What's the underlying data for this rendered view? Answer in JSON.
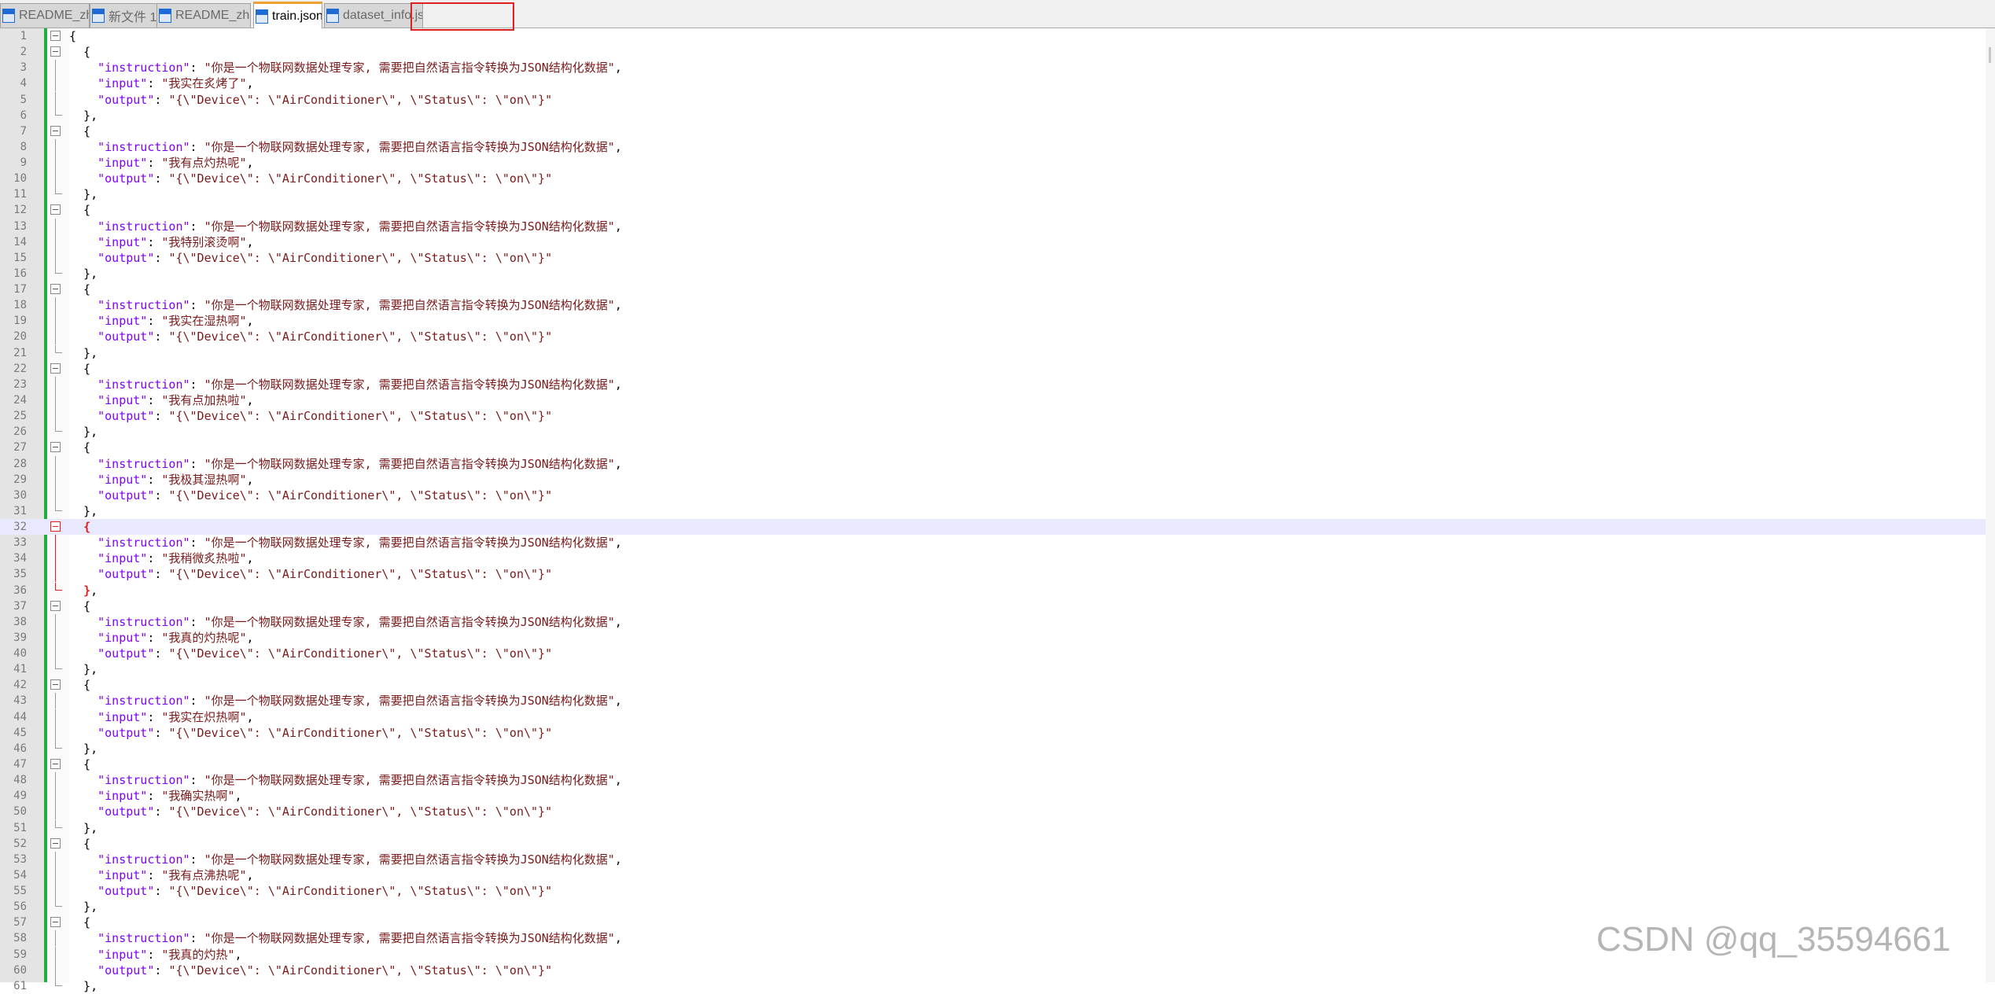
{
  "tabs": [
    {
      "label": "README_zh.md",
      "active": false
    },
    {
      "label": "新文件 1",
      "active": false
    },
    {
      "label": "README_zh.md",
      "active": false
    },
    {
      "label": "train.json",
      "active": true,
      "icons": [
        "pin-icon",
        "close-icon"
      ]
    },
    {
      "label": "dataset_info.json",
      "active": false
    }
  ],
  "editor": {
    "current_line": 32,
    "lines": [
      {
        "n": "1",
        "t": [
          [
            "p",
            "{"
          ]
        ],
        "f": "box"
      },
      {
        "n": "2",
        "t": [
          [
            "p",
            "  {"
          ]
        ],
        "f": "box"
      },
      {
        "n": "3",
        "t": [
          [
            "p",
            "    "
          ],
          [
            "k",
            "\"instruction\""
          ],
          [
            "p",
            ": "
          ],
          [
            "s",
            "\"你是一个物联网数据处理专家, 需要把自然语言指令转换为JSON结构化数据\""
          ],
          [
            "p",
            ","
          ]
        ],
        "f": "line"
      },
      {
        "n": "4",
        "t": [
          [
            "p",
            "    "
          ],
          [
            "k",
            "\"input\""
          ],
          [
            "p",
            ": "
          ],
          [
            "s",
            "\"我实在炙烤了\""
          ],
          [
            "p",
            ","
          ]
        ],
        "f": "line"
      },
      {
        "n": "5",
        "t": [
          [
            "p",
            "    "
          ],
          [
            "k",
            "\"output\""
          ],
          [
            "p",
            ": "
          ],
          [
            "s",
            "\"{\\\"Device\\\": \\\"AirConditioner\\\", \\\"Status\\\": \\\"on\\\"}\""
          ]
        ],
        "f": "line"
      },
      {
        "n": "6",
        "t": [
          [
            "p",
            "  },"
          ]
        ],
        "f": "end"
      },
      {
        "n": "7",
        "t": [
          [
            "p",
            "  {"
          ]
        ],
        "f": "box"
      },
      {
        "n": "8",
        "t": [
          [
            "p",
            "    "
          ],
          [
            "k",
            "\"instruction\""
          ],
          [
            "p",
            ": "
          ],
          [
            "s",
            "\"你是一个物联网数据处理专家, 需要把自然语言指令转换为JSON结构化数据\""
          ],
          [
            "p",
            ","
          ]
        ],
        "f": "line"
      },
      {
        "n": "9",
        "t": [
          [
            "p",
            "    "
          ],
          [
            "k",
            "\"input\""
          ],
          [
            "p",
            ": "
          ],
          [
            "s",
            "\"我有点灼热呢\""
          ],
          [
            "p",
            ","
          ]
        ],
        "f": "line"
      },
      {
        "n": "10",
        "t": [
          [
            "p",
            "    "
          ],
          [
            "k",
            "\"output\""
          ],
          [
            "p",
            ": "
          ],
          [
            "s",
            "\"{\\\"Device\\\": \\\"AirConditioner\\\", \\\"Status\\\": \\\"on\\\"}\""
          ]
        ],
        "f": "line"
      },
      {
        "n": "11",
        "t": [
          [
            "p",
            "  },"
          ]
        ],
        "f": "end"
      },
      {
        "n": "12",
        "t": [
          [
            "p",
            "  {"
          ]
        ],
        "f": "box"
      },
      {
        "n": "13",
        "t": [
          [
            "p",
            "    "
          ],
          [
            "k",
            "\"instruction\""
          ],
          [
            "p",
            ": "
          ],
          [
            "s",
            "\"你是一个物联网数据处理专家, 需要把自然语言指令转换为JSON结构化数据\""
          ],
          [
            "p",
            ","
          ]
        ],
        "f": "line"
      },
      {
        "n": "14",
        "t": [
          [
            "p",
            "    "
          ],
          [
            "k",
            "\"input\""
          ],
          [
            "p",
            ": "
          ],
          [
            "s",
            "\"我特别滚烫啊\""
          ],
          [
            "p",
            ","
          ]
        ],
        "f": "line"
      },
      {
        "n": "15",
        "t": [
          [
            "p",
            "    "
          ],
          [
            "k",
            "\"output\""
          ],
          [
            "p",
            ": "
          ],
          [
            "s",
            "\"{\\\"Device\\\": \\\"AirConditioner\\\", \\\"Status\\\": \\\"on\\\"}\""
          ]
        ],
        "f": "line"
      },
      {
        "n": "16",
        "t": [
          [
            "p",
            "  },"
          ]
        ],
        "f": "end"
      },
      {
        "n": "17",
        "t": [
          [
            "p",
            "  {"
          ]
        ],
        "f": "box"
      },
      {
        "n": "18",
        "t": [
          [
            "p",
            "    "
          ],
          [
            "k",
            "\"instruction\""
          ],
          [
            "p",
            ": "
          ],
          [
            "s",
            "\"你是一个物联网数据处理专家, 需要把自然语言指令转换为JSON结构化数据\""
          ],
          [
            "p",
            ","
          ]
        ],
        "f": "line"
      },
      {
        "n": "19",
        "t": [
          [
            "p",
            "    "
          ],
          [
            "k",
            "\"input\""
          ],
          [
            "p",
            ": "
          ],
          [
            "s",
            "\"我实在湿热啊\""
          ],
          [
            "p",
            ","
          ]
        ],
        "f": "line"
      },
      {
        "n": "20",
        "t": [
          [
            "p",
            "    "
          ],
          [
            "k",
            "\"output\""
          ],
          [
            "p",
            ": "
          ],
          [
            "s",
            "\"{\\\"Device\\\": \\\"AirConditioner\\\", \\\"Status\\\": \\\"on\\\"}\""
          ]
        ],
        "f": "line"
      },
      {
        "n": "21",
        "t": [
          [
            "p",
            "  },"
          ]
        ],
        "f": "end"
      },
      {
        "n": "22",
        "t": [
          [
            "p",
            "  {"
          ]
        ],
        "f": "box"
      },
      {
        "n": "23",
        "t": [
          [
            "p",
            "    "
          ],
          [
            "k",
            "\"instruction\""
          ],
          [
            "p",
            ": "
          ],
          [
            "s",
            "\"你是一个物联网数据处理专家, 需要把自然语言指令转换为JSON结构化数据\""
          ],
          [
            "p",
            ","
          ]
        ],
        "f": "line"
      },
      {
        "n": "24",
        "t": [
          [
            "p",
            "    "
          ],
          [
            "k",
            "\"input\""
          ],
          [
            "p",
            ": "
          ],
          [
            "s",
            "\"我有点加热啦\""
          ],
          [
            "p",
            ","
          ]
        ],
        "f": "line"
      },
      {
        "n": "25",
        "t": [
          [
            "p",
            "    "
          ],
          [
            "k",
            "\"output\""
          ],
          [
            "p",
            ": "
          ],
          [
            "s",
            "\"{\\\"Device\\\": \\\"AirConditioner\\\", \\\"Status\\\": \\\"on\\\"}\""
          ]
        ],
        "f": "line"
      },
      {
        "n": "26",
        "t": [
          [
            "p",
            "  },"
          ]
        ],
        "f": "end"
      },
      {
        "n": "27",
        "t": [
          [
            "p",
            "  {"
          ]
        ],
        "f": "box"
      },
      {
        "n": "28",
        "t": [
          [
            "p",
            "    "
          ],
          [
            "k",
            "\"instruction\""
          ],
          [
            "p",
            ": "
          ],
          [
            "s",
            "\"你是一个物联网数据处理专家, 需要把自然语言指令转换为JSON结构化数据\""
          ],
          [
            "p",
            ","
          ]
        ],
        "f": "line"
      },
      {
        "n": "29",
        "t": [
          [
            "p",
            "    "
          ],
          [
            "k",
            "\"input\""
          ],
          [
            "p",
            ": "
          ],
          [
            "s",
            "\"我极其湿热啊\""
          ],
          [
            "p",
            ","
          ]
        ],
        "f": "line"
      },
      {
        "n": "30",
        "t": [
          [
            "p",
            "    "
          ],
          [
            "k",
            "\"output\""
          ],
          [
            "p",
            ": "
          ],
          [
            "s",
            "\"{\\\"Device\\\": \\\"AirConditioner\\\", \\\"Status\\\": \\\"on\\\"}\""
          ]
        ],
        "f": "line"
      },
      {
        "n": "31",
        "t": [
          [
            "p",
            "  },"
          ]
        ],
        "f": "end"
      },
      {
        "n": "32",
        "t": [
          [
            "p",
            "  "
          ],
          [
            "p match",
            "{"
          ]
        ],
        "f": "box red"
      },
      {
        "n": "33",
        "t": [
          [
            "p",
            "    "
          ],
          [
            "k",
            "\"instruction\""
          ],
          [
            "p",
            ": "
          ],
          [
            "s",
            "\"你是一个物联网数据处理专家, 需要把自然语言指令转换为JSON结构化数据\""
          ],
          [
            "p",
            ","
          ]
        ],
        "f": "line red"
      },
      {
        "n": "34",
        "t": [
          [
            "p",
            "    "
          ],
          [
            "k",
            "\"input\""
          ],
          [
            "p",
            ": "
          ],
          [
            "s",
            "\"我稍微炙热啦\""
          ],
          [
            "p",
            ","
          ]
        ],
        "f": "line red"
      },
      {
        "n": "35",
        "t": [
          [
            "p",
            "    "
          ],
          [
            "k",
            "\"output\""
          ],
          [
            "p",
            ": "
          ],
          [
            "s",
            "\"{\\\"Device\\\": \\\"AirConditioner\\\", \\\"Status\\\": \\\"on\\\"}\""
          ]
        ],
        "f": "line red"
      },
      {
        "n": "36",
        "t": [
          [
            "p",
            "  "
          ],
          [
            "p match",
            "}"
          ],
          [
            "p",
            ","
          ]
        ],
        "f": "end red"
      },
      {
        "n": "37",
        "t": [
          [
            "p",
            "  {"
          ]
        ],
        "f": "box"
      },
      {
        "n": "38",
        "t": [
          [
            "p",
            "    "
          ],
          [
            "k",
            "\"instruction\""
          ],
          [
            "p",
            ": "
          ],
          [
            "s",
            "\"你是一个物联网数据处理专家, 需要把自然语言指令转换为JSON结构化数据\""
          ],
          [
            "p",
            ","
          ]
        ],
        "f": "line"
      },
      {
        "n": "39",
        "t": [
          [
            "p",
            "    "
          ],
          [
            "k",
            "\"input\""
          ],
          [
            "p",
            ": "
          ],
          [
            "s",
            "\"我真的灼热呢\""
          ],
          [
            "p",
            ","
          ]
        ],
        "f": "line"
      },
      {
        "n": "40",
        "t": [
          [
            "p",
            "    "
          ],
          [
            "k",
            "\"output\""
          ],
          [
            "p",
            ": "
          ],
          [
            "s",
            "\"{\\\"Device\\\": \\\"AirConditioner\\\", \\\"Status\\\": \\\"on\\\"}\""
          ]
        ],
        "f": "line"
      },
      {
        "n": "41",
        "t": [
          [
            "p",
            "  },"
          ]
        ],
        "f": "end"
      },
      {
        "n": "42",
        "t": [
          [
            "p",
            "  {"
          ]
        ],
        "f": "box"
      },
      {
        "n": "43",
        "t": [
          [
            "p",
            "    "
          ],
          [
            "k",
            "\"instruction\""
          ],
          [
            "p",
            ": "
          ],
          [
            "s",
            "\"你是一个物联网数据处理专家, 需要把自然语言指令转换为JSON结构化数据\""
          ],
          [
            "p",
            ","
          ]
        ],
        "f": "line"
      },
      {
        "n": "44",
        "t": [
          [
            "p",
            "    "
          ],
          [
            "k",
            "\"input\""
          ],
          [
            "p",
            ": "
          ],
          [
            "s",
            "\"我实在炽热啊\""
          ],
          [
            "p",
            ","
          ]
        ],
        "f": "line"
      },
      {
        "n": "45",
        "t": [
          [
            "p",
            "    "
          ],
          [
            "k",
            "\"output\""
          ],
          [
            "p",
            ": "
          ],
          [
            "s",
            "\"{\\\"Device\\\": \\\"AirConditioner\\\", \\\"Status\\\": \\\"on\\\"}\""
          ]
        ],
        "f": "line"
      },
      {
        "n": "46",
        "t": [
          [
            "p",
            "  },"
          ]
        ],
        "f": "end"
      },
      {
        "n": "47",
        "t": [
          [
            "p",
            "  {"
          ]
        ],
        "f": "box"
      },
      {
        "n": "48",
        "t": [
          [
            "p",
            "    "
          ],
          [
            "k",
            "\"instruction\""
          ],
          [
            "p",
            ": "
          ],
          [
            "s",
            "\"你是一个物联网数据处理专家, 需要把自然语言指令转换为JSON结构化数据\""
          ],
          [
            "p",
            ","
          ]
        ],
        "f": "line"
      },
      {
        "n": "49",
        "t": [
          [
            "p",
            "    "
          ],
          [
            "k",
            "\"input\""
          ],
          [
            "p",
            ": "
          ],
          [
            "s",
            "\"我确实热啊\""
          ],
          [
            "p",
            ","
          ]
        ],
        "f": "line"
      },
      {
        "n": "50",
        "t": [
          [
            "p",
            "    "
          ],
          [
            "k",
            "\"output\""
          ],
          [
            "p",
            ": "
          ],
          [
            "s",
            "\"{\\\"Device\\\": \\\"AirConditioner\\\", \\\"Status\\\": \\\"on\\\"}\""
          ]
        ],
        "f": "line"
      },
      {
        "n": "51",
        "t": [
          [
            "p",
            "  },"
          ]
        ],
        "f": "end"
      },
      {
        "n": "52",
        "t": [
          [
            "p",
            "  {"
          ]
        ],
        "f": "box"
      },
      {
        "n": "53",
        "t": [
          [
            "p",
            "    "
          ],
          [
            "k",
            "\"instruction\""
          ],
          [
            "p",
            ": "
          ],
          [
            "s",
            "\"你是一个物联网数据处理专家, 需要把自然语言指令转换为JSON结构化数据\""
          ],
          [
            "p",
            ","
          ]
        ],
        "f": "line"
      },
      {
        "n": "54",
        "t": [
          [
            "p",
            "    "
          ],
          [
            "k",
            "\"input\""
          ],
          [
            "p",
            ": "
          ],
          [
            "s",
            "\"我有点沸热呢\""
          ],
          [
            "p",
            ","
          ]
        ],
        "f": "line"
      },
      {
        "n": "55",
        "t": [
          [
            "p",
            "    "
          ],
          [
            "k",
            "\"output\""
          ],
          [
            "p",
            ": "
          ],
          [
            "s",
            "\"{\\\"Device\\\": \\\"AirConditioner\\\", \\\"Status\\\": \\\"on\\\"}\""
          ]
        ],
        "f": "line"
      },
      {
        "n": "56",
        "t": [
          [
            "p",
            "  },"
          ]
        ],
        "f": "end"
      },
      {
        "n": "57",
        "t": [
          [
            "p",
            "  {"
          ]
        ],
        "f": "box"
      },
      {
        "n": "58",
        "t": [
          [
            "p",
            "    "
          ],
          [
            "k",
            "\"instruction\""
          ],
          [
            "p",
            ": "
          ],
          [
            "s",
            "\"你是一个物联网数据处理专家, 需要把自然语言指令转换为JSON结构化数据\""
          ],
          [
            "p",
            ","
          ]
        ],
        "f": "line"
      },
      {
        "n": "59",
        "t": [
          [
            "p",
            "    "
          ],
          [
            "k",
            "\"input\""
          ],
          [
            "p",
            ": "
          ],
          [
            "s",
            "\"我真的灼热\""
          ],
          [
            "p",
            ","
          ]
        ],
        "f": "line"
      },
      {
        "n": "60",
        "t": [
          [
            "p",
            "    "
          ],
          [
            "k",
            "\"output\""
          ],
          [
            "p",
            ": "
          ],
          [
            "s",
            "\"{\\\"Device\\\": \\\"AirConditioner\\\", \\\"Status\\\": \\\"on\\\"}\""
          ]
        ],
        "f": "line"
      },
      {
        "n": "61",
        "t": [
          [
            "p",
            "  },"
          ]
        ],
        "f": "end"
      }
    ]
  },
  "colors": {
    "keyword": "#8000ff",
    "string": "#7a1a1a",
    "punctuation": "#000000",
    "brace_match": "#e02020",
    "current_line": "#e8e8ff",
    "change_bar": "#1fae3c",
    "tab_accent": "#f0a030",
    "highlight_box": "#e02020"
  },
  "watermark": "CSDN @qq_35594661"
}
